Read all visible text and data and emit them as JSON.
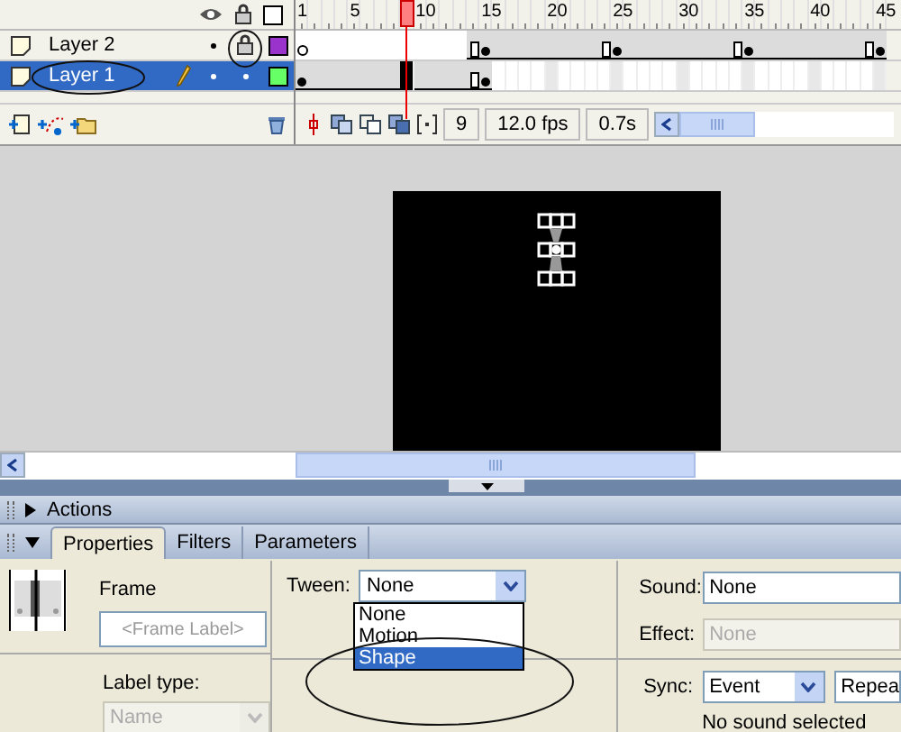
{
  "timeline": {
    "ruler": [
      {
        "label": "1"
      },
      {
        "label": "5"
      },
      {
        "label": "10"
      },
      {
        "label": "15"
      },
      {
        "label": "20"
      },
      {
        "label": "25"
      },
      {
        "label": "30"
      },
      {
        "label": "35"
      },
      {
        "label": "40"
      },
      {
        "label": "45"
      }
    ],
    "layers": [
      {
        "name": "Layer 2",
        "selected": false,
        "editing": false,
        "locked": true,
        "lock_circled": true,
        "name_circled": false,
        "color": "#9933cc",
        "frames": [
          {
            "kind": "empty-key"
          },
          {
            "kind": "blank"
          },
          {
            "kind": "blank"
          },
          {
            "kind": "blank"
          },
          {
            "kind": "blank"
          },
          {
            "kind": "blank"
          },
          {
            "kind": "blank"
          },
          {
            "kind": "blank"
          },
          {
            "kind": "blank"
          },
          {
            "kind": "blank"
          },
          {
            "kind": "blank"
          },
          {
            "kind": "blank"
          },
          {
            "kind": "blank"
          },
          {
            "kind": "end"
          },
          {
            "kind": "key"
          },
          {
            "kind": "span"
          },
          {
            "kind": "span"
          },
          {
            "kind": "span"
          },
          {
            "kind": "span"
          },
          {
            "kind": "span"
          },
          {
            "kind": "span"
          },
          {
            "kind": "span"
          },
          {
            "kind": "span"
          },
          {
            "kind": "end"
          },
          {
            "kind": "key"
          },
          {
            "kind": "span"
          },
          {
            "kind": "span"
          },
          {
            "kind": "span"
          },
          {
            "kind": "span"
          },
          {
            "kind": "span"
          },
          {
            "kind": "span"
          },
          {
            "kind": "span"
          },
          {
            "kind": "span"
          },
          {
            "kind": "end"
          },
          {
            "kind": "key"
          },
          {
            "kind": "span"
          },
          {
            "kind": "span"
          },
          {
            "kind": "span"
          },
          {
            "kind": "span"
          },
          {
            "kind": "span"
          },
          {
            "kind": "span"
          },
          {
            "kind": "span"
          },
          {
            "kind": "span"
          },
          {
            "kind": "end"
          },
          {
            "kind": "key"
          }
        ]
      },
      {
        "name": "Layer 1",
        "selected": true,
        "editing": true,
        "locked": false,
        "lock_circled": false,
        "name_circled": true,
        "color": "#66ff66",
        "frames": [
          {
            "kind": "key"
          },
          {
            "kind": "span"
          },
          {
            "kind": "span"
          },
          {
            "kind": "span"
          },
          {
            "kind": "span"
          },
          {
            "kind": "span"
          },
          {
            "kind": "span"
          },
          {
            "kind": "span"
          },
          {
            "kind": "selected"
          },
          {
            "kind": "span"
          },
          {
            "kind": "span"
          },
          {
            "kind": "span"
          },
          {
            "kind": "span"
          },
          {
            "kind": "end"
          },
          {
            "kind": "key"
          }
        ]
      }
    ],
    "frame_number": "9",
    "frame_rate": "12.0 fps",
    "elapsed": "0.7s"
  },
  "panels": [
    {
      "title": "Actions",
      "expanded": false
    }
  ],
  "properties": {
    "expanded": true,
    "tabs": [
      {
        "label": "Properties",
        "selected": true
      },
      {
        "label": "Filters",
        "selected": false
      },
      {
        "label": "Parameters",
        "selected": false
      }
    ],
    "frame_heading": "Frame",
    "frame_label_placeholder": "<Frame Label>",
    "label_type_label": "Label type:",
    "label_type_value": "Name",
    "label_type_disabled": true,
    "tween_label": "Tween:",
    "tween_value": "None",
    "tween_options": [
      {
        "label": "None",
        "selected": false,
        "circled": false
      },
      {
        "label": "Motion",
        "selected": false,
        "circled": false
      },
      {
        "label": "Shape",
        "selected": true,
        "circled": true
      }
    ],
    "sound_label": "Sound:",
    "sound_value": "None",
    "effect_label": "Effect:",
    "effect_value": "None",
    "effect_disabled": true,
    "sync_label": "Sync:",
    "sync_value": "Event",
    "repeat_value": "Repea",
    "sound_status": "No sound selected"
  }
}
